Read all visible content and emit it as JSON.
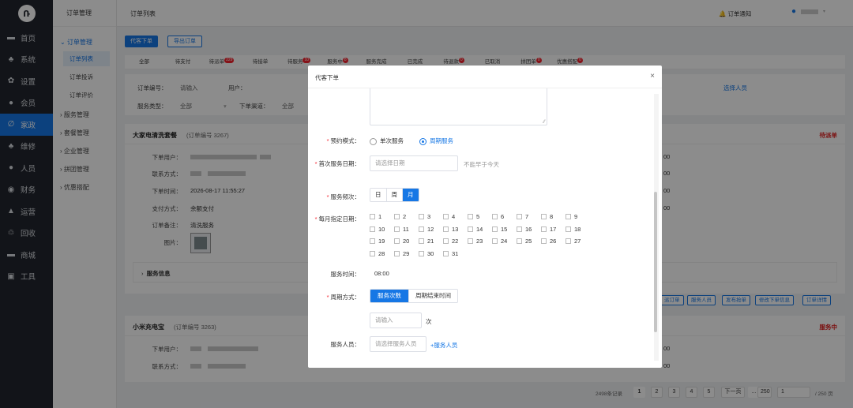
{
  "left_nav": {
    "logo": "Ռ",
    "items": [
      {
        "icon": "▬",
        "icon_name": "home-icon",
        "label": "首页"
      },
      {
        "icon": "♣",
        "icon_name": "system-icon",
        "label": "系统"
      },
      {
        "icon": "✿",
        "icon_name": "settings-icon",
        "label": "设置"
      },
      {
        "icon": "●",
        "icon_name": "member-icon",
        "label": "会员"
      },
      {
        "icon": "∅",
        "icon_name": "housekeeping-icon",
        "label": "家政"
      },
      {
        "icon": "♣",
        "icon_name": "repair-icon",
        "label": "维修"
      },
      {
        "icon": "●",
        "icon_name": "staff-icon",
        "label": "人员"
      },
      {
        "icon": "◉",
        "icon_name": "finance-icon",
        "label": "财务"
      },
      {
        "icon": "▲",
        "icon_name": "operations-icon",
        "label": "运营"
      },
      {
        "icon": "♲",
        "icon_name": "recycle-icon",
        "label": "回收"
      },
      {
        "icon": "▬",
        "icon_name": "mall-icon",
        "label": "商城"
      },
      {
        "icon": "▣",
        "icon_name": "tools-icon",
        "label": "工具"
      }
    ],
    "active_index": 4
  },
  "sub_nav": {
    "header": "订单管理",
    "open_group": "订单管理",
    "children": [
      "订单列表",
      "订单投诉",
      "订单评价"
    ],
    "groups": [
      "服务管理",
      "套餐管理",
      "企业管理",
      "拼团管理",
      "优惠搭配"
    ]
  },
  "topbar": {
    "title": "订单列表",
    "notice_icon": "🔔",
    "notice": "订单通知",
    "user_icon": "●",
    "caret": "▾"
  },
  "toolbar": {
    "proxy_order": "代客下单",
    "export_order": "导出订单"
  },
  "tabs": [
    {
      "label": "全部",
      "badge": ""
    },
    {
      "label": "待支付",
      "badge": ""
    },
    {
      "label": "待派单",
      "badge": "229"
    },
    {
      "label": "待接单",
      "badge": ""
    },
    {
      "label": "待服务",
      "badge": "10"
    },
    {
      "label": "服务中",
      "badge": "8"
    },
    {
      "label": "服务完成",
      "badge": ""
    },
    {
      "label": "已完成",
      "badge": ""
    },
    {
      "label": "待退款",
      "badge": "0"
    },
    {
      "label": "已取消",
      "badge": ""
    },
    {
      "label": "拼团单",
      "badge": "0"
    },
    {
      "label": "优惠搭配",
      "badge": "0"
    }
  ],
  "filter": {
    "order_no_label": "订单编号：",
    "order_no_placeholder": "请输入",
    "user_label": "用户：",
    "service_type_label": "服务类型：",
    "service_type_value": "全部",
    "channel_label": "下单渠道：",
    "channel_value": "全部",
    "select_staff": "选择人员"
  },
  "order1": {
    "title": "大家电清洗套餐",
    "order_no": "(订单编号 3267)",
    "status": "待派单",
    "user_label": "下单用户：",
    "contact_label": "联系方式：",
    "time_label": "下单时间：",
    "time_value": "2026-08-17 11:55:27",
    "pay_label": "支付方式：",
    "pay_value": "余额支付",
    "remark_label": "订单备注：",
    "remark_value": "清洗服务",
    "image_label": "图片：",
    "service_info": "服务信息",
    "right_values": [
      "00",
      "00",
      "00",
      "00"
    ]
  },
  "order_actions": [
    "派订单",
    "服务人员",
    "发布抢单",
    "修改下单信息",
    "订单详情"
  ],
  "order2": {
    "title": "小米充电宝",
    "order_no": "(订单编号 3263)",
    "status": "服务中",
    "user_label": "下单用户：",
    "contact_label": "联系方式：",
    "right_values": [
      "00",
      "00"
    ]
  },
  "pager": {
    "total": "2498条记录",
    "pages": [
      "1",
      "2",
      "3",
      "4",
      "5"
    ],
    "next": "下一页",
    "ellipsis": "...",
    "last": "250",
    "jump_value": "1",
    "total_pages": "/ 250 页"
  },
  "modal": {
    "title": "代客下单",
    "close": "×",
    "mode_label": "预约模式：",
    "mode_options": [
      "单次服务",
      "周期服务"
    ],
    "mode_selected": "周期服务",
    "first_date_label": "首次服务日期：",
    "first_date_placeholder": "请选择日期",
    "first_date_hint": "不能早于今天",
    "freq_label": "服务频次：",
    "freq_options": [
      "日",
      "周",
      "月"
    ],
    "freq_selected": "月",
    "days_label": "每月指定日期：",
    "days": [
      "1",
      "2",
      "3",
      "4",
      "5",
      "6",
      "7",
      "8",
      "9",
      "10",
      "11",
      "12",
      "13",
      "14",
      "15",
      "16",
      "17",
      "18",
      "19",
      "20",
      "21",
      "22",
      "23",
      "24",
      "25",
      "26",
      "27",
      "28",
      "29",
      "30",
      "31"
    ],
    "time_label": "服务时间：",
    "time_value": "08:00",
    "cycle_label": "周期方式：",
    "cycle_options": [
      "服务次数",
      "周期结束时间"
    ],
    "cycle_selected": "服务次数",
    "count_placeholder": "请输入",
    "count_unit": "次",
    "staff_label": "服务人员：",
    "staff_placeholder": "请选择服务人员",
    "add_staff": "+服务人员"
  },
  "colors": {
    "primary": "#1677e5",
    "danger": "#e02020",
    "nav_bg": "#22262e"
  }
}
